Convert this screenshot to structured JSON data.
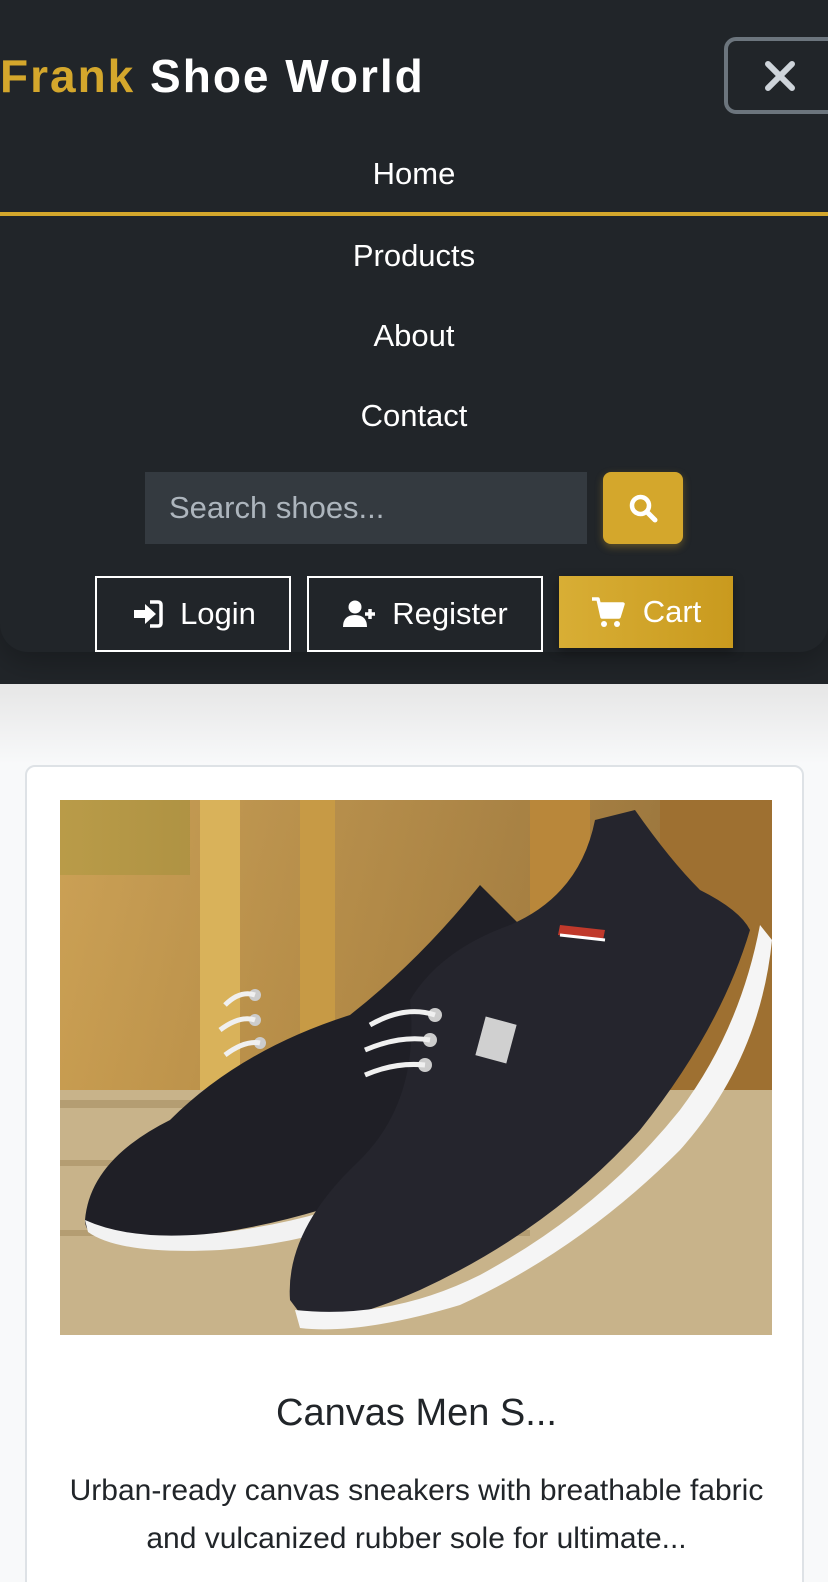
{
  "brand": {
    "first": "Frank",
    "rest": "Shoe World"
  },
  "nav": {
    "items": [
      {
        "label": "Home",
        "active": true
      },
      {
        "label": "Products",
        "active": false
      },
      {
        "label": "About",
        "active": false
      },
      {
        "label": "Contact",
        "active": false
      }
    ]
  },
  "search": {
    "placeholder": "Search shoes..."
  },
  "auth": {
    "login_label": "Login",
    "register_label": "Register"
  },
  "cart": {
    "label": "Cart"
  },
  "product": {
    "title": "Canvas Men S...",
    "description": "Urban-ready canvas sneakers with breathable fabric and vulcanized rubber sole for ultimate..."
  },
  "colors": {
    "navbar_bg": "#212529",
    "accent_gold": "#d4a72c",
    "text_white": "#ffffff",
    "search_bg": "#343a40"
  },
  "icons": {
    "close": "close-icon",
    "search": "search-icon",
    "login": "sign-in-icon",
    "register": "user-plus-icon",
    "cart": "cart-icon"
  }
}
